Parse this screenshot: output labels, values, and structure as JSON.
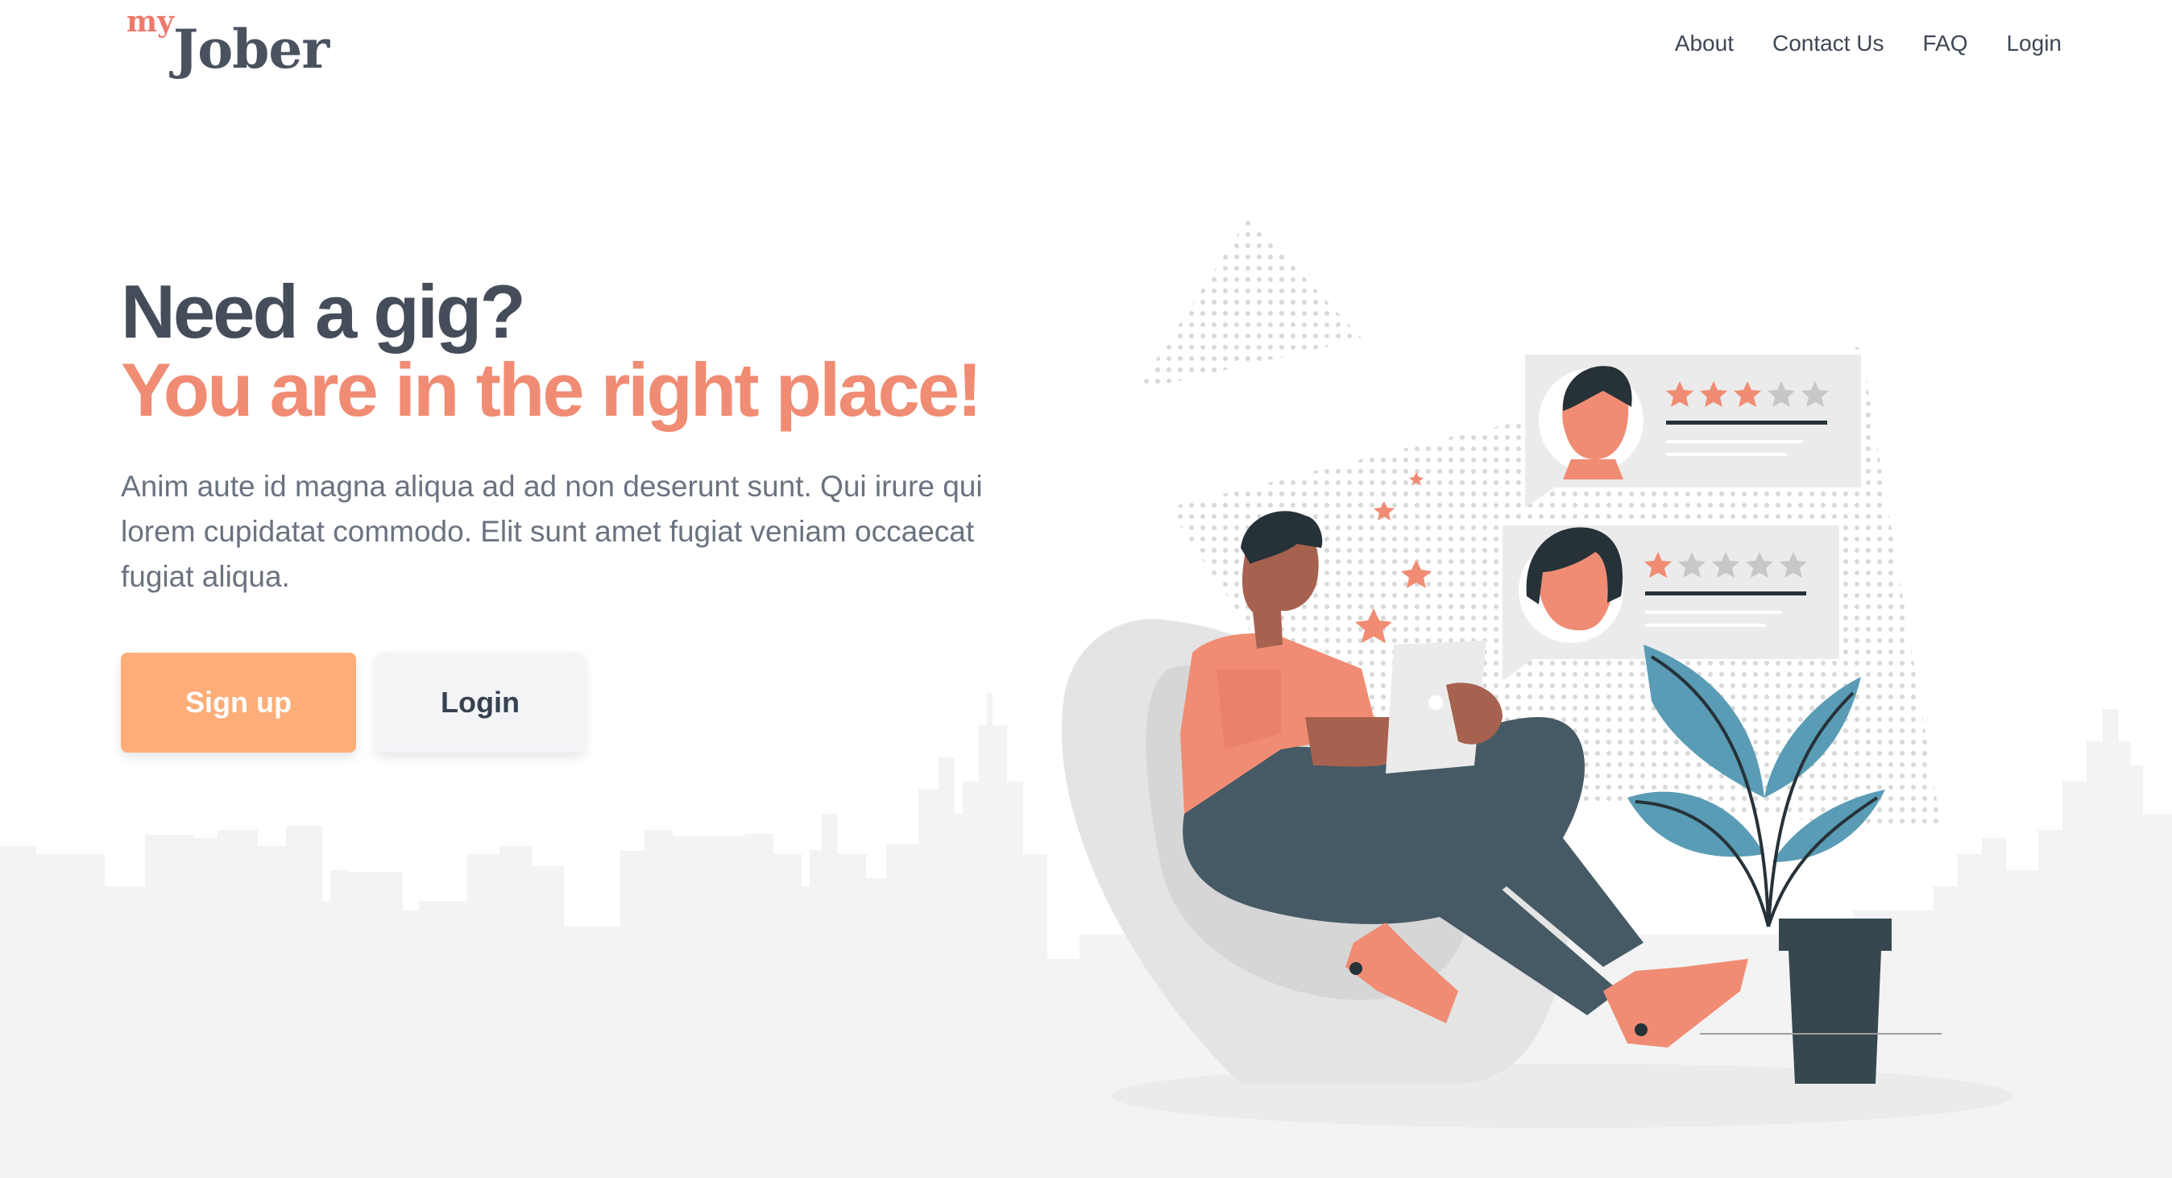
{
  "brand": {
    "logo_small": "my",
    "logo_main": "Jober"
  },
  "nav": {
    "items": [
      {
        "label": "About"
      },
      {
        "label": "Contact Us"
      },
      {
        "label": "FAQ"
      },
      {
        "label": "Login"
      }
    ]
  },
  "hero": {
    "headline": "Need a gig?",
    "subheadline": "You are in the right place!",
    "description": "Anim aute id magna aliqua ad ad non deserunt sunt. Qui irure qui lorem cupidatat commodo. Elit sunt amet fugiat veniam occaecat fugiat aliqua."
  },
  "buttons": {
    "signup_label": "Sign up",
    "login_label": "Login"
  },
  "reviews": [
    {
      "rating": 3,
      "max": 5
    },
    {
      "rating": 1,
      "max": 5
    }
  ],
  "colors": {
    "accent": "#f08c73",
    "button_primary": "#fdad78",
    "text_dark": "#454d5b",
    "text_muted": "#6b7280",
    "skyline": "#f3f3f3"
  }
}
